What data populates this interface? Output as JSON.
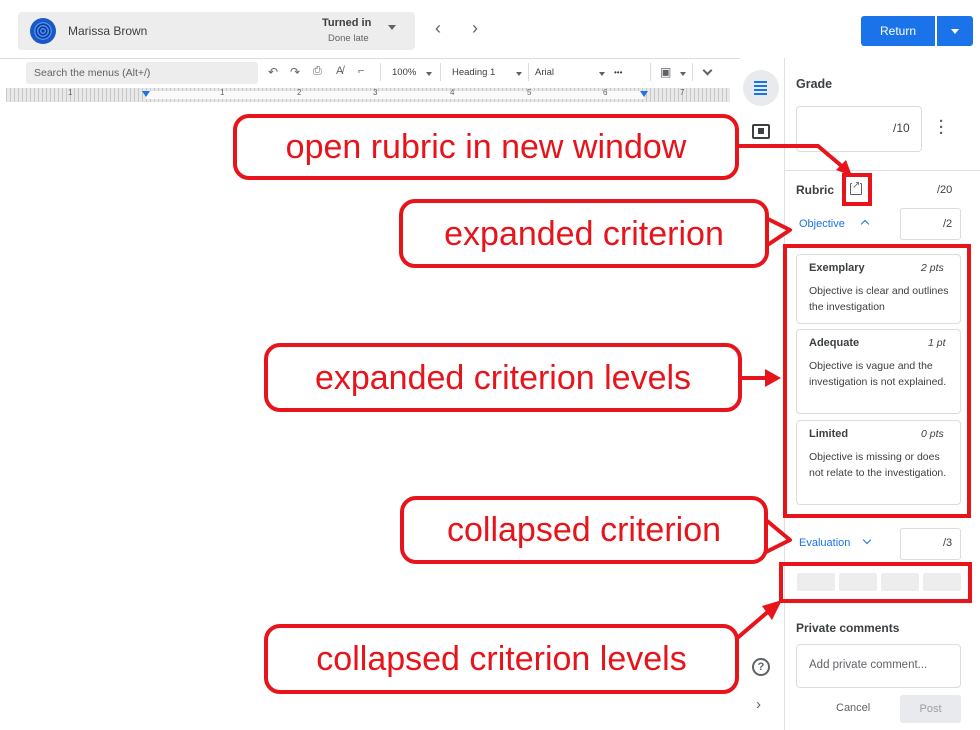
{
  "student": {
    "name": "Marissa Brown",
    "status": "Turned in",
    "substatus": "Done late"
  },
  "actions": {
    "return_label": "Return"
  },
  "toolbar": {
    "search_placeholder": "Search the menus (Alt+/)",
    "zoom": "100%",
    "style": "Heading 1",
    "font": "Arial",
    "more": "•••"
  },
  "ruler": {
    "numbers": [
      "1",
      "1",
      "2",
      "3",
      "4",
      "5",
      "6",
      "7"
    ]
  },
  "grade": {
    "label": "Grade",
    "value": "/10"
  },
  "rubric": {
    "label": "Rubric",
    "total": "/20",
    "criteria": [
      {
        "name": "Objective",
        "score": "/2",
        "levels": [
          {
            "title": "Exemplary",
            "points": "2 pts",
            "description": "Objective is clear and outlines the investigation"
          },
          {
            "title": "Adequate",
            "points": "1 pt",
            "description": "Objective is vague and the investigation is not explained."
          },
          {
            "title": "Limited",
            "points": "0 pts",
            "description": "Objective is missing or does not relate to the investigation."
          }
        ]
      },
      {
        "name": "Evaluation",
        "score": "/3"
      }
    ]
  },
  "comments": {
    "label": "Private comments",
    "placeholder": "Add private comment...",
    "cancel_label": "Cancel",
    "post_label": "Post"
  },
  "help": {
    "glyph": "?"
  },
  "annotations": {
    "open_rubric": "open rubric in new window",
    "expanded_criterion": "expanded criterion",
    "expanded_levels": "expanded criterion levels",
    "collapsed_criterion": "collapsed criterion",
    "collapsed_levels": "collapsed criterion levels"
  },
  "colors": {
    "accent": "#1a73e8",
    "annotation": "#e8141b"
  }
}
